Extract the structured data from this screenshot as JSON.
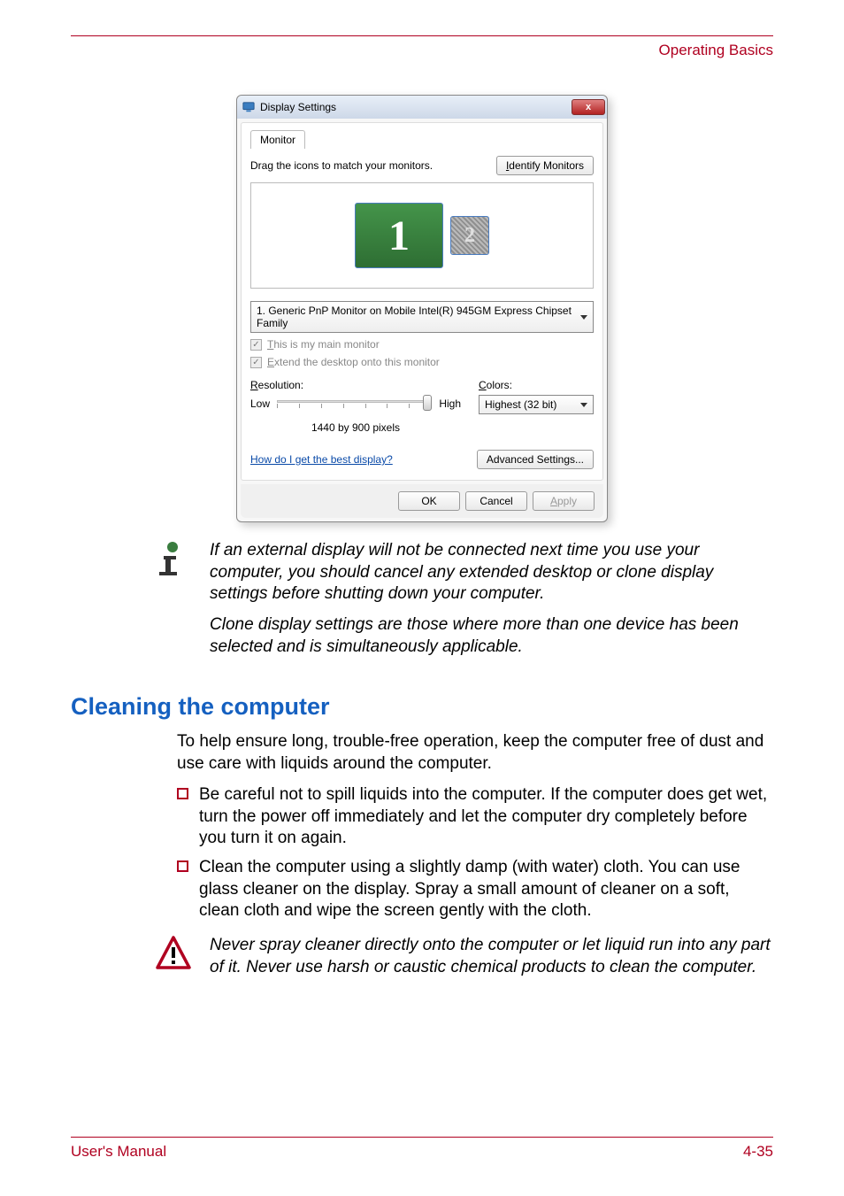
{
  "header": {
    "section_name": "Operating Basics"
  },
  "dialog": {
    "title": "Display Settings",
    "close_glyph": "x",
    "tab": "Monitor",
    "instruction": "Drag the icons to match your monitors.",
    "identify_btn": "Identify Monitors",
    "mon1": "1",
    "mon2": "2",
    "dropdown_value": "1. Generic PnP Monitor on Mobile Intel(R) 945GM Express Chipset Family",
    "chk1": "This is my main monitor",
    "chk2": "Extend the desktop onto this monitor",
    "resolution_label": "Resolution:",
    "low": "Low",
    "high": "High",
    "res_value": "1440 by 900 pixels",
    "colors_label": "Colors:",
    "colors_value": "Highest (32 bit)",
    "help_link": "How do I get the best display?",
    "advanced_btn": "Advanced Settings...",
    "ok": "OK",
    "cancel": "Cancel",
    "apply": "Apply"
  },
  "note": {
    "p1": "If an external display will not be connected next time you use your computer, you should cancel any extended desktop or clone display settings before shutting down your computer.",
    "p2": "Clone display settings are those where more than one device has been selected and is simultaneously applicable."
  },
  "section_heading": "Cleaning the computer",
  "body": {
    "intro": "To help ensure long, trouble-free operation, keep the computer free of dust and use care with liquids around the computer.",
    "b1": "Be careful not to spill liquids into the computer. If the computer does get wet, turn the power off immediately and let the computer dry completely before you turn it on again.",
    "b2": "Clean the computer using a slightly damp (with water) cloth. You can use glass cleaner on the display. Spray a small amount of cleaner on a soft, clean cloth and wipe the screen gently with the cloth."
  },
  "caution": {
    "text": "Never spray cleaner directly onto the computer or let liquid run into any part of it. Never use harsh or caustic chemical products to clean the computer."
  },
  "footer": {
    "left": "User's Manual",
    "right": "4-35"
  }
}
